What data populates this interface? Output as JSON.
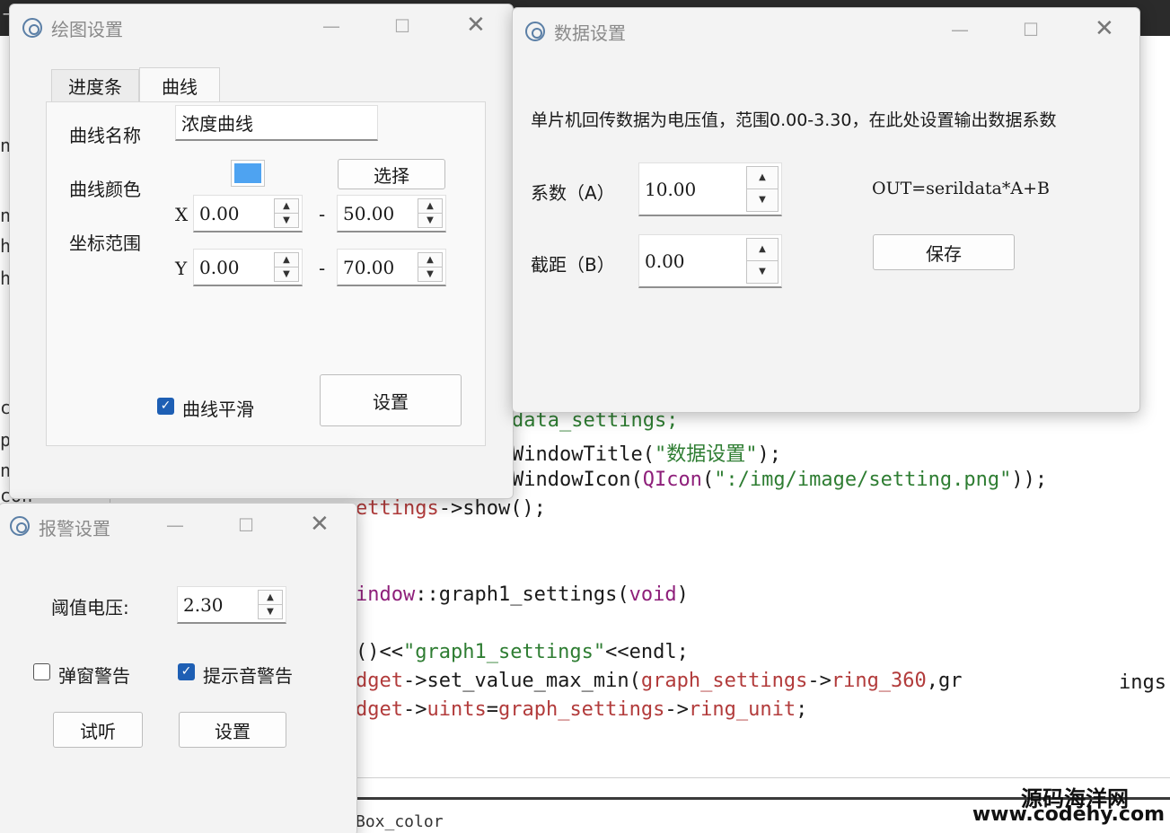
{
  "editor": {
    "code_lines": [
      {
        "parts": [
          {
            "t": "data_settings;",
            "c": "c-green"
          }
        ]
      },
      {
        "parts": [
          {
            "t": "WindowTitle(",
            "c": ""
          },
          {
            "t": "\"数据设置\"",
            "c": "c-green"
          },
          {
            "t": ");",
            "c": ""
          }
        ]
      },
      {
        "parts": [
          {
            "t": "WindowIcon(",
            "c": ""
          },
          {
            "t": "QIcon",
            "c": "c-purple"
          },
          {
            "t": "(",
            "c": ""
          },
          {
            "t": "\":/img/image/setting.png\"",
            "c": "c-green"
          },
          {
            "t": "));",
            "c": ""
          }
        ]
      },
      {
        "parts": [
          {
            "t": "ettings",
            "c": "c-red"
          },
          {
            "t": "->show();",
            "c": ""
          }
        ]
      },
      {
        "parts": [
          {
            "t": "indow",
            "c": "c-purple"
          },
          {
            "t": "::graph1_settings(",
            "c": ""
          },
          {
            "t": "void",
            "c": "c-purple"
          },
          {
            "t": ")",
            "c": ""
          }
        ]
      },
      {
        "parts": [
          {
            "t": "()<<",
            "c": ""
          },
          {
            "t": "\"graph1_settings\"",
            "c": "c-green"
          },
          {
            "t": "<<endl;",
            "c": ""
          }
        ]
      },
      {
        "parts": [
          {
            "t": "dget",
            "c": "c-red"
          },
          {
            "t": "->set_value_max_min(",
            "c": ""
          },
          {
            "t": "graph_settings",
            "c": "c-red"
          },
          {
            "t": "->",
            "c": ""
          },
          {
            "t": "ring_360",
            "c": "c-red"
          },
          {
            "t": ",gr",
            "c": ""
          }
        ]
      },
      {
        "parts": [
          {
            "t": "dget",
            "c": "c-red"
          },
          {
            "t": "->",
            "c": ""
          },
          {
            "t": "uints",
            "c": "c-red"
          },
          {
            "t": "=",
            "c": ""
          },
          {
            "t": "graph_settings",
            "c": "c-red"
          },
          {
            "t": "->",
            "c": ""
          },
          {
            "t": "ring_unit",
            "c": "c-red"
          },
          {
            "t": ";",
            "c": ""
          }
        ]
      }
    ],
    "trailing_fragment": "ings",
    "bottom_code": "Box_color",
    "left_fragments": [
      "ㄱ",
      "n",
      "n.",
      "h",
      "h",
      "c",
      "p",
      "n.",
      "con"
    ],
    "watermark_line1": "源码海洋网",
    "watermark_line2": "www.codehy.com"
  },
  "plot_dialog": {
    "title": "绘图设置",
    "tabs": [
      {
        "label": "进度条",
        "active": false
      },
      {
        "label": "曲线",
        "active": true
      }
    ],
    "curve_name_label": "曲线名称",
    "curve_name_value": "浓度曲线",
    "curve_color_label": "曲线颜色",
    "color_value": "#4ea3f1",
    "select_button": "选择",
    "range_label": "坐标范围",
    "x_label": "X",
    "y_label": "Y",
    "range_dash": "-",
    "x_min": "0.00",
    "x_max": "50.00",
    "y_min": "0.00",
    "y_max": "70.00",
    "smooth_label": "曲线平滑",
    "smooth_checked": true,
    "set_button": "设置"
  },
  "data_dialog": {
    "title": "数据设置",
    "description": "单片机回传数据为电压值，范围0.00-3.30，在此处设置输出数据系数",
    "coef_label": "系数（A）",
    "coef_value": "10.00",
    "intercept_label": "截距（B）",
    "intercept_value": "0.00",
    "formula": "OUT=serildata*A+B",
    "save_button": "保存"
  },
  "alarm_dialog": {
    "title": "报警设置",
    "threshold_label": "阈值电压:",
    "threshold_value": "2.30",
    "popup_label": "弹窗警告",
    "popup_checked": false,
    "sound_label": "提示音警告",
    "sound_checked": true,
    "listen_button": "试听",
    "set_button": "设置"
  },
  "window_controls": {
    "minimize": "—",
    "maximize": "☐",
    "close": "✕"
  },
  "icons": {
    "title": "gear-icon",
    "checked": "check-icon"
  }
}
